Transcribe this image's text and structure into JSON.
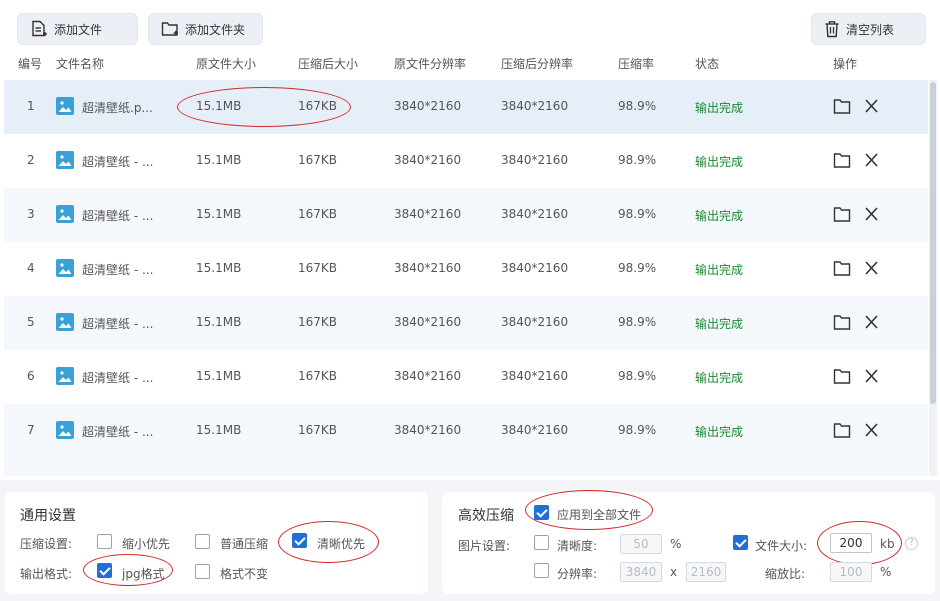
{
  "toolbar": {
    "add_file": "添加文件",
    "add_folder": "添加文件夹",
    "clear_list": "清空列表"
  },
  "columns": [
    "编号",
    "文件名称",
    "原文件大小",
    "压缩后大小",
    "原文件分辨率",
    "压缩后分辨率",
    "压缩率",
    "状态",
    "操作"
  ],
  "rows": [
    {
      "no": "1",
      "name": "超清壁纸.p...",
      "orig_size": "15.1MB",
      "comp_size": "167KB",
      "orig_res": "3840*2160",
      "comp_res": "3840*2160",
      "ratio": "98.9%",
      "status": "输出完成"
    },
    {
      "no": "2",
      "name": "超清壁纸 - ...",
      "orig_size": "15.1MB",
      "comp_size": "167KB",
      "orig_res": "3840*2160",
      "comp_res": "3840*2160",
      "ratio": "98.9%",
      "status": "输出完成"
    },
    {
      "no": "3",
      "name": "超清壁纸 - ...",
      "orig_size": "15.1MB",
      "comp_size": "167KB",
      "orig_res": "3840*2160",
      "comp_res": "3840*2160",
      "ratio": "98.9%",
      "status": "输出完成"
    },
    {
      "no": "4",
      "name": "超清壁纸 - ...",
      "orig_size": "15.1MB",
      "comp_size": "167KB",
      "orig_res": "3840*2160",
      "comp_res": "3840*2160",
      "ratio": "98.9%",
      "status": "输出完成"
    },
    {
      "no": "5",
      "name": "超清壁纸 - ...",
      "orig_size": "15.1MB",
      "comp_size": "167KB",
      "orig_res": "3840*2160",
      "comp_res": "3840*2160",
      "ratio": "98.9%",
      "status": "输出完成"
    },
    {
      "no": "6",
      "name": "超清壁纸 - ...",
      "orig_size": "15.1MB",
      "comp_size": "167KB",
      "orig_res": "3840*2160",
      "comp_res": "3840*2160",
      "ratio": "98.9%",
      "status": "输出完成"
    },
    {
      "no": "7",
      "name": "超清壁纸 - ...",
      "orig_size": "15.1MB",
      "comp_size": "167KB",
      "orig_res": "3840*2160",
      "comp_res": "3840*2160",
      "ratio": "98.9%",
      "status": "输出完成"
    }
  ],
  "general": {
    "title": "通用设置",
    "compress_label": "压缩设置:",
    "opt_small": "缩小优先",
    "opt_normal": "普通压缩",
    "opt_clear": "清晰优先",
    "opt_small_checked": false,
    "opt_normal_checked": false,
    "opt_clear_checked": true,
    "output_label": "输出格式:",
    "fmt_jpg": "jpg格式",
    "fmt_keep": "格式不变",
    "fmt_jpg_checked": true,
    "fmt_keep_checked": false
  },
  "efficient": {
    "title": "高效压缩",
    "apply_all": "应用到全部文件",
    "apply_all_checked": true,
    "image_label": "图片设置:",
    "clarity_label": "清晰度:",
    "clarity_checked": false,
    "clarity_value": "50",
    "percent": "%",
    "size_label": "文件大小:",
    "size_checked": true,
    "size_value": "200",
    "size_unit": "kb",
    "help": "?",
    "res_label": "分辨率:",
    "res_checked": false,
    "res_w": "3840",
    "res_x": "x",
    "res_h": "2160",
    "scale_label": "缩放比:",
    "scale_value": "100",
    "scale_unit": "%"
  },
  "colors": {
    "accent": "#1f6fd6",
    "status_ok": "#1c8a2f",
    "annotation": "#d4282a"
  }
}
